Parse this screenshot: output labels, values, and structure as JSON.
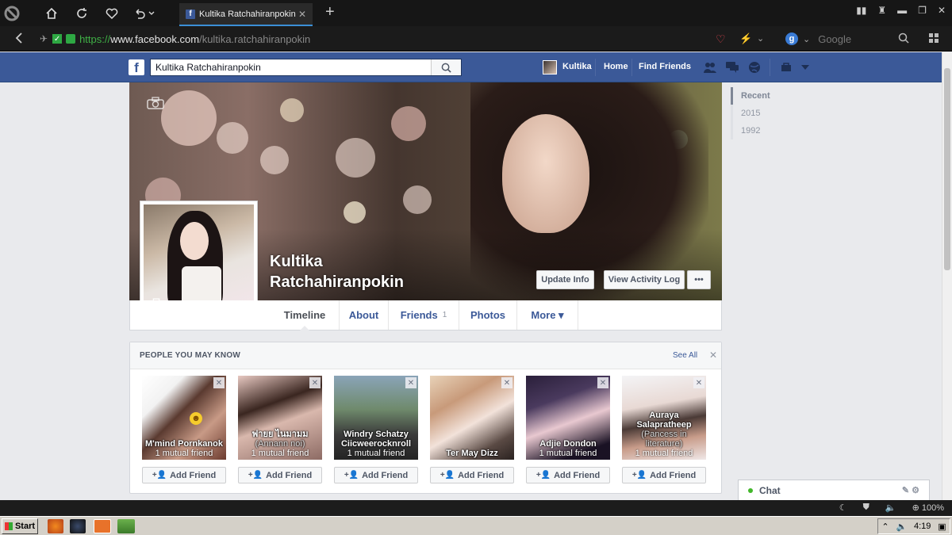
{
  "browser": {
    "tab_title": "Kultika Ratchahiranpokin",
    "tab_favicon": "f",
    "url_scheme": "https://",
    "url_host": "www.facebook.com",
    "url_path": "/kultika.ratchahiranpokin",
    "search_engine_letter": "g",
    "search_placeholder": "Google"
  },
  "fb": {
    "logo": "f",
    "search_value": "Kultika Ratchahiranpokin",
    "nav": {
      "profile_name": "Kultika",
      "home": "Home",
      "find_friends": "Find Friends"
    }
  },
  "profile": {
    "name_line1": "Kultika",
    "name_line2": "Ratchahiranpokin",
    "update_info": "Update Info",
    "view_activity_log": "View Activity Log",
    "more_dots": "•••",
    "tabs": [
      {
        "label": "Timeline"
      },
      {
        "label": "About"
      },
      {
        "label": "Friends",
        "count": "1"
      },
      {
        "label": "Photos"
      },
      {
        "label": "More ▾"
      }
    ]
  },
  "pymk": {
    "title": "PEOPLE YOU MAY KNOW",
    "see_all": "See All",
    "add_label": "Add Friend",
    "people": [
      {
        "name": "M'mind Pornkanok",
        "sub": "",
        "mutual": "1 mutual friend"
      },
      {
        "name": "ฟายย ไนมามม",
        "sub": "(Annann noi)",
        "mutual": "1 mutual friend"
      },
      {
        "name": "Windry Schatzy",
        "sub": "Ciicweerocknroll",
        "mutual": "1 mutual friend"
      },
      {
        "name": "Ter May Dizz",
        "sub": "",
        "mutual": ""
      },
      {
        "name": "Adjie Dondon",
        "sub": "",
        "mutual": "1 mutual friend"
      },
      {
        "name": "Auraya Salapratheep",
        "sub": "(Pancess in literature)",
        "mutual": "1 mutual friend"
      }
    ]
  },
  "timeline_nav": {
    "years": [
      "Recent",
      "2015",
      "1992"
    ]
  },
  "chat": {
    "label": "Chat"
  },
  "statusbar": {
    "zoom": "100%"
  },
  "taskbar": {
    "start": "Start",
    "time": "4:19"
  },
  "colors": {
    "fb_blue": "#3b5998",
    "online_green": "#42b72a",
    "secure_green": "#3fb046"
  }
}
